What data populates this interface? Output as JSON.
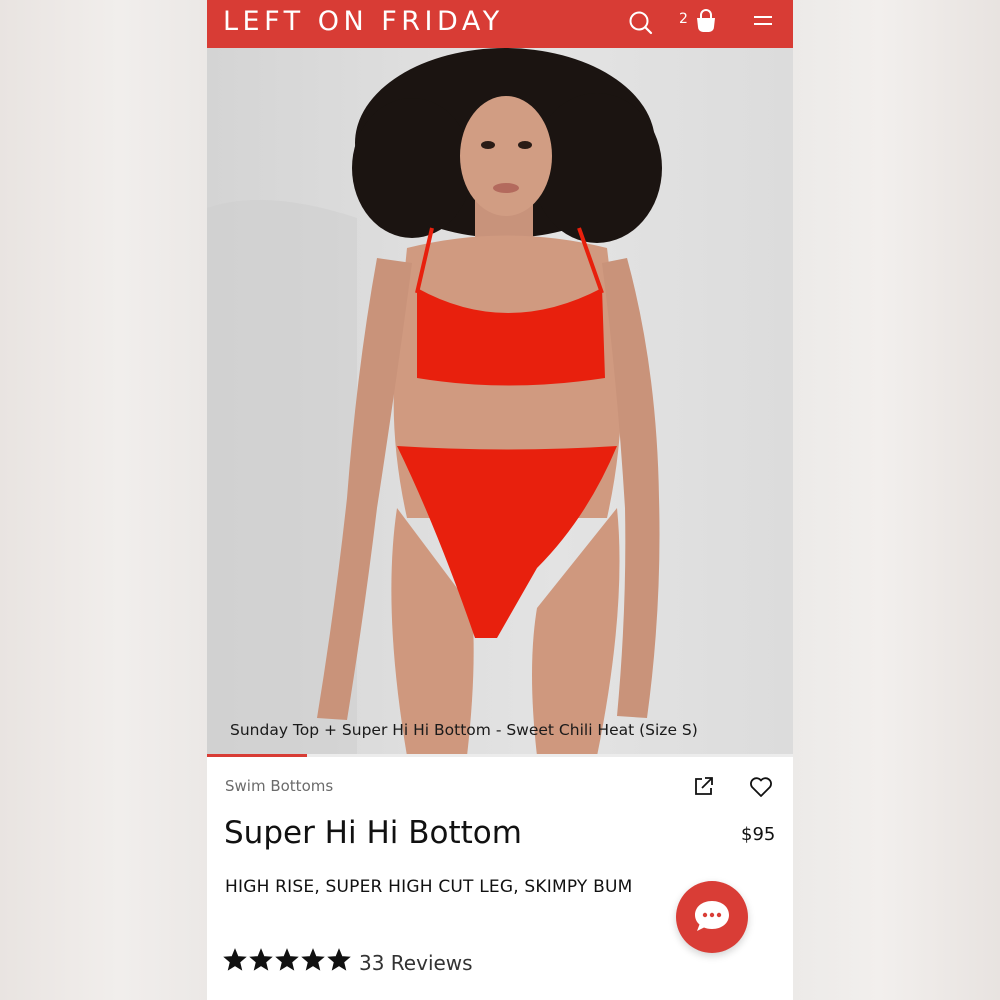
{
  "header": {
    "brand": "LEFT ON FRIDAY",
    "cart_count": "2",
    "icons": [
      "search-icon",
      "bag-icon",
      "menu-icon"
    ],
    "color": "#d83c35"
  },
  "hero": {
    "caption": "Sunday Top + Super Hi Hi Bottom - Sweet Chili Heat (Size S)",
    "gallery_progress": 0.17
  },
  "product": {
    "category": "Swim Bottoms",
    "title": "Super Hi Hi Bottom",
    "price": "$95",
    "description": "HIGH RISE, SUPER HIGH CUT LEG, SKIMPY BUM",
    "rating": 5,
    "reviews_label": "33 Reviews"
  },
  "actions": {
    "icons": [
      "share-icon",
      "heart-icon",
      "chat-icon"
    ]
  }
}
